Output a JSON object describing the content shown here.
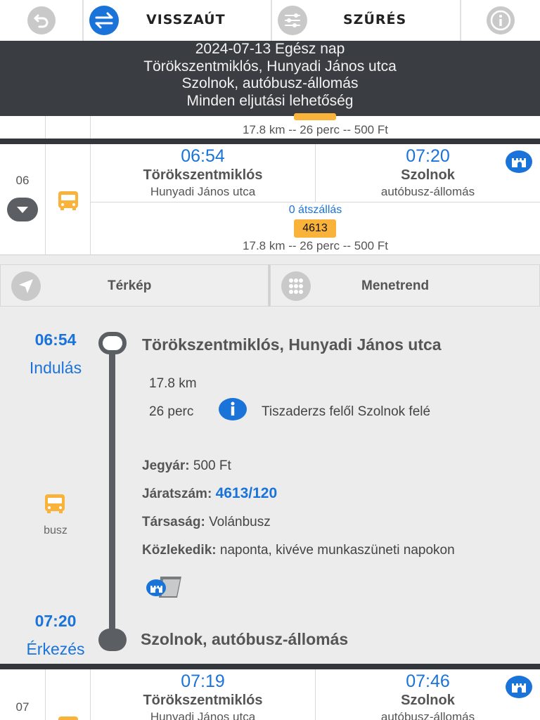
{
  "toolbar": {
    "back_icon": "undo-arrow-icon",
    "swap_icon": "swap-arrows-icon",
    "return_label": "VISSZAÚT",
    "filter_icon": "sliders-icon",
    "filter_label": "SZŰRÉS",
    "info_icon": "info-icon"
  },
  "summary": {
    "line1": "2024-07-13 Egész nap",
    "line2": "Törökszentmiklós, Hunyadi János utca",
    "line3": "Szolnok, autóbusz-állomás",
    "line4": "Minden eljutási lehetőség"
  },
  "prev_row": {
    "info": "17.8 km -- 26 perc -- 500 Ft"
  },
  "row06": {
    "num": "06",
    "dep_time": "06:54",
    "dep_stop": "Törökszentmiklós",
    "dep_sub": "Hunyadi János utca",
    "arr_time": "07:20",
    "arr_stop": "Szolnok",
    "arr_sub": "autóbusz-állomás",
    "transfers": "0 átszállás",
    "route": "4613",
    "info": "17.8 km -- 26 perc -- 500 Ft"
  },
  "tabs": {
    "map_label": "Térkép",
    "timetable_label": "Menetrend"
  },
  "detail": {
    "dep_time": "06:54",
    "dep_label": "Indulás",
    "dep_stop": "Törökszentmiklós, Hunyadi János utca",
    "distance": "17.8 km",
    "duration": "26 perc",
    "direction": "Tiszaderzs felől Szolnok felé",
    "mode_label": "busz",
    "fare_key": "Jegyár:",
    "fare_val": "500 Ft",
    "trip_key": "Járatszám:",
    "trip_val": "4613/120",
    "company_key": "Társaság:",
    "company_val": "Volánbusz",
    "runs_key": "Közlekedik:",
    "runs_val": "naponta, kivéve munkaszüneti napokon",
    "arr_time": "07:20",
    "arr_label": "Érkezés",
    "arr_stop": "Szolnok, autóbusz-állomás"
  },
  "row07": {
    "num": "07",
    "dep_time": "07:19",
    "dep_stop": "Törökszentmiklós",
    "dep_sub": "Hunyadi János utca",
    "arr_time": "07:46",
    "arr_stop": "Szolnok",
    "arr_sub": "autóbusz-állomás"
  },
  "colors": {
    "accent_blue": "#1a73d9",
    "bus_orange": "#f9b23a",
    "header_dark": "#3a3d42"
  }
}
